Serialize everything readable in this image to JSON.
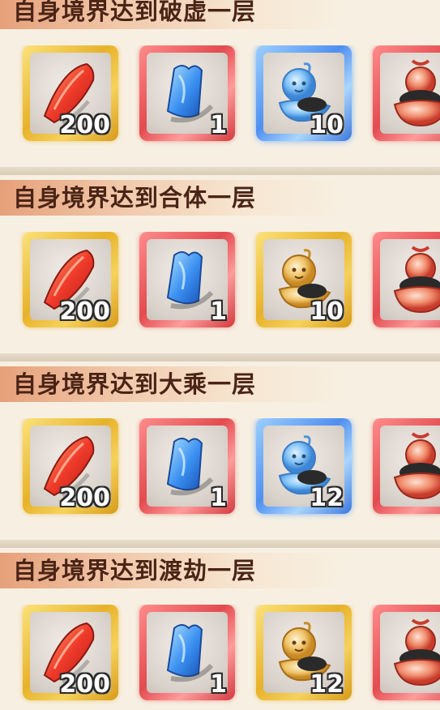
{
  "sections": [
    {
      "title": "自身境界达到破虚一层",
      "items": [
        {
          "icon": "red-crystal-shard-icon",
          "frame": "gold",
          "qty": "200"
        },
        {
          "icon": "blue-talisman-cloth-icon",
          "frame": "red",
          "qty": "1"
        },
        {
          "icon": "blue-spirit-pouch-icon",
          "frame": "blue",
          "qty": "10"
        },
        {
          "icon": "red-treasure-pouch-icon",
          "frame": "red",
          "qty": ""
        }
      ]
    },
    {
      "title": "自身境界达到合体一层",
      "items": [
        {
          "icon": "red-crystal-shard-icon",
          "frame": "gold",
          "qty": "200"
        },
        {
          "icon": "blue-talisman-cloth-icon",
          "frame": "red",
          "qty": "1"
        },
        {
          "icon": "gold-spirit-pouch-icon",
          "frame": "gold",
          "qty": "10"
        },
        {
          "icon": "red-treasure-pouch-icon",
          "frame": "red",
          "qty": ""
        }
      ]
    },
    {
      "title": "自身境界达到大乘一层",
      "items": [
        {
          "icon": "red-crystal-shard-icon",
          "frame": "gold",
          "qty": "200"
        },
        {
          "icon": "blue-talisman-cloth-icon",
          "frame": "red",
          "qty": "1"
        },
        {
          "icon": "blue-spirit-pouch-icon",
          "frame": "blue",
          "qty": "12"
        },
        {
          "icon": "red-treasure-pouch-icon",
          "frame": "red",
          "qty": ""
        }
      ]
    },
    {
      "title": "自身境界达到渡劫一层",
      "items": [
        {
          "icon": "red-crystal-shard-icon",
          "frame": "gold",
          "qty": "200"
        },
        {
          "icon": "blue-talisman-cloth-icon",
          "frame": "red",
          "qty": "1"
        },
        {
          "icon": "gold-spirit-pouch-icon",
          "frame": "gold",
          "qty": "12"
        },
        {
          "icon": "red-treasure-pouch-icon",
          "frame": "red",
          "qty": ""
        }
      ]
    }
  ],
  "colors": {
    "background": "#f7f0e2",
    "title_text": "#4a2416",
    "gold_frame": "#e7b22a",
    "red_frame": "#e34b4f",
    "blue_frame": "#4f8ff0"
  }
}
